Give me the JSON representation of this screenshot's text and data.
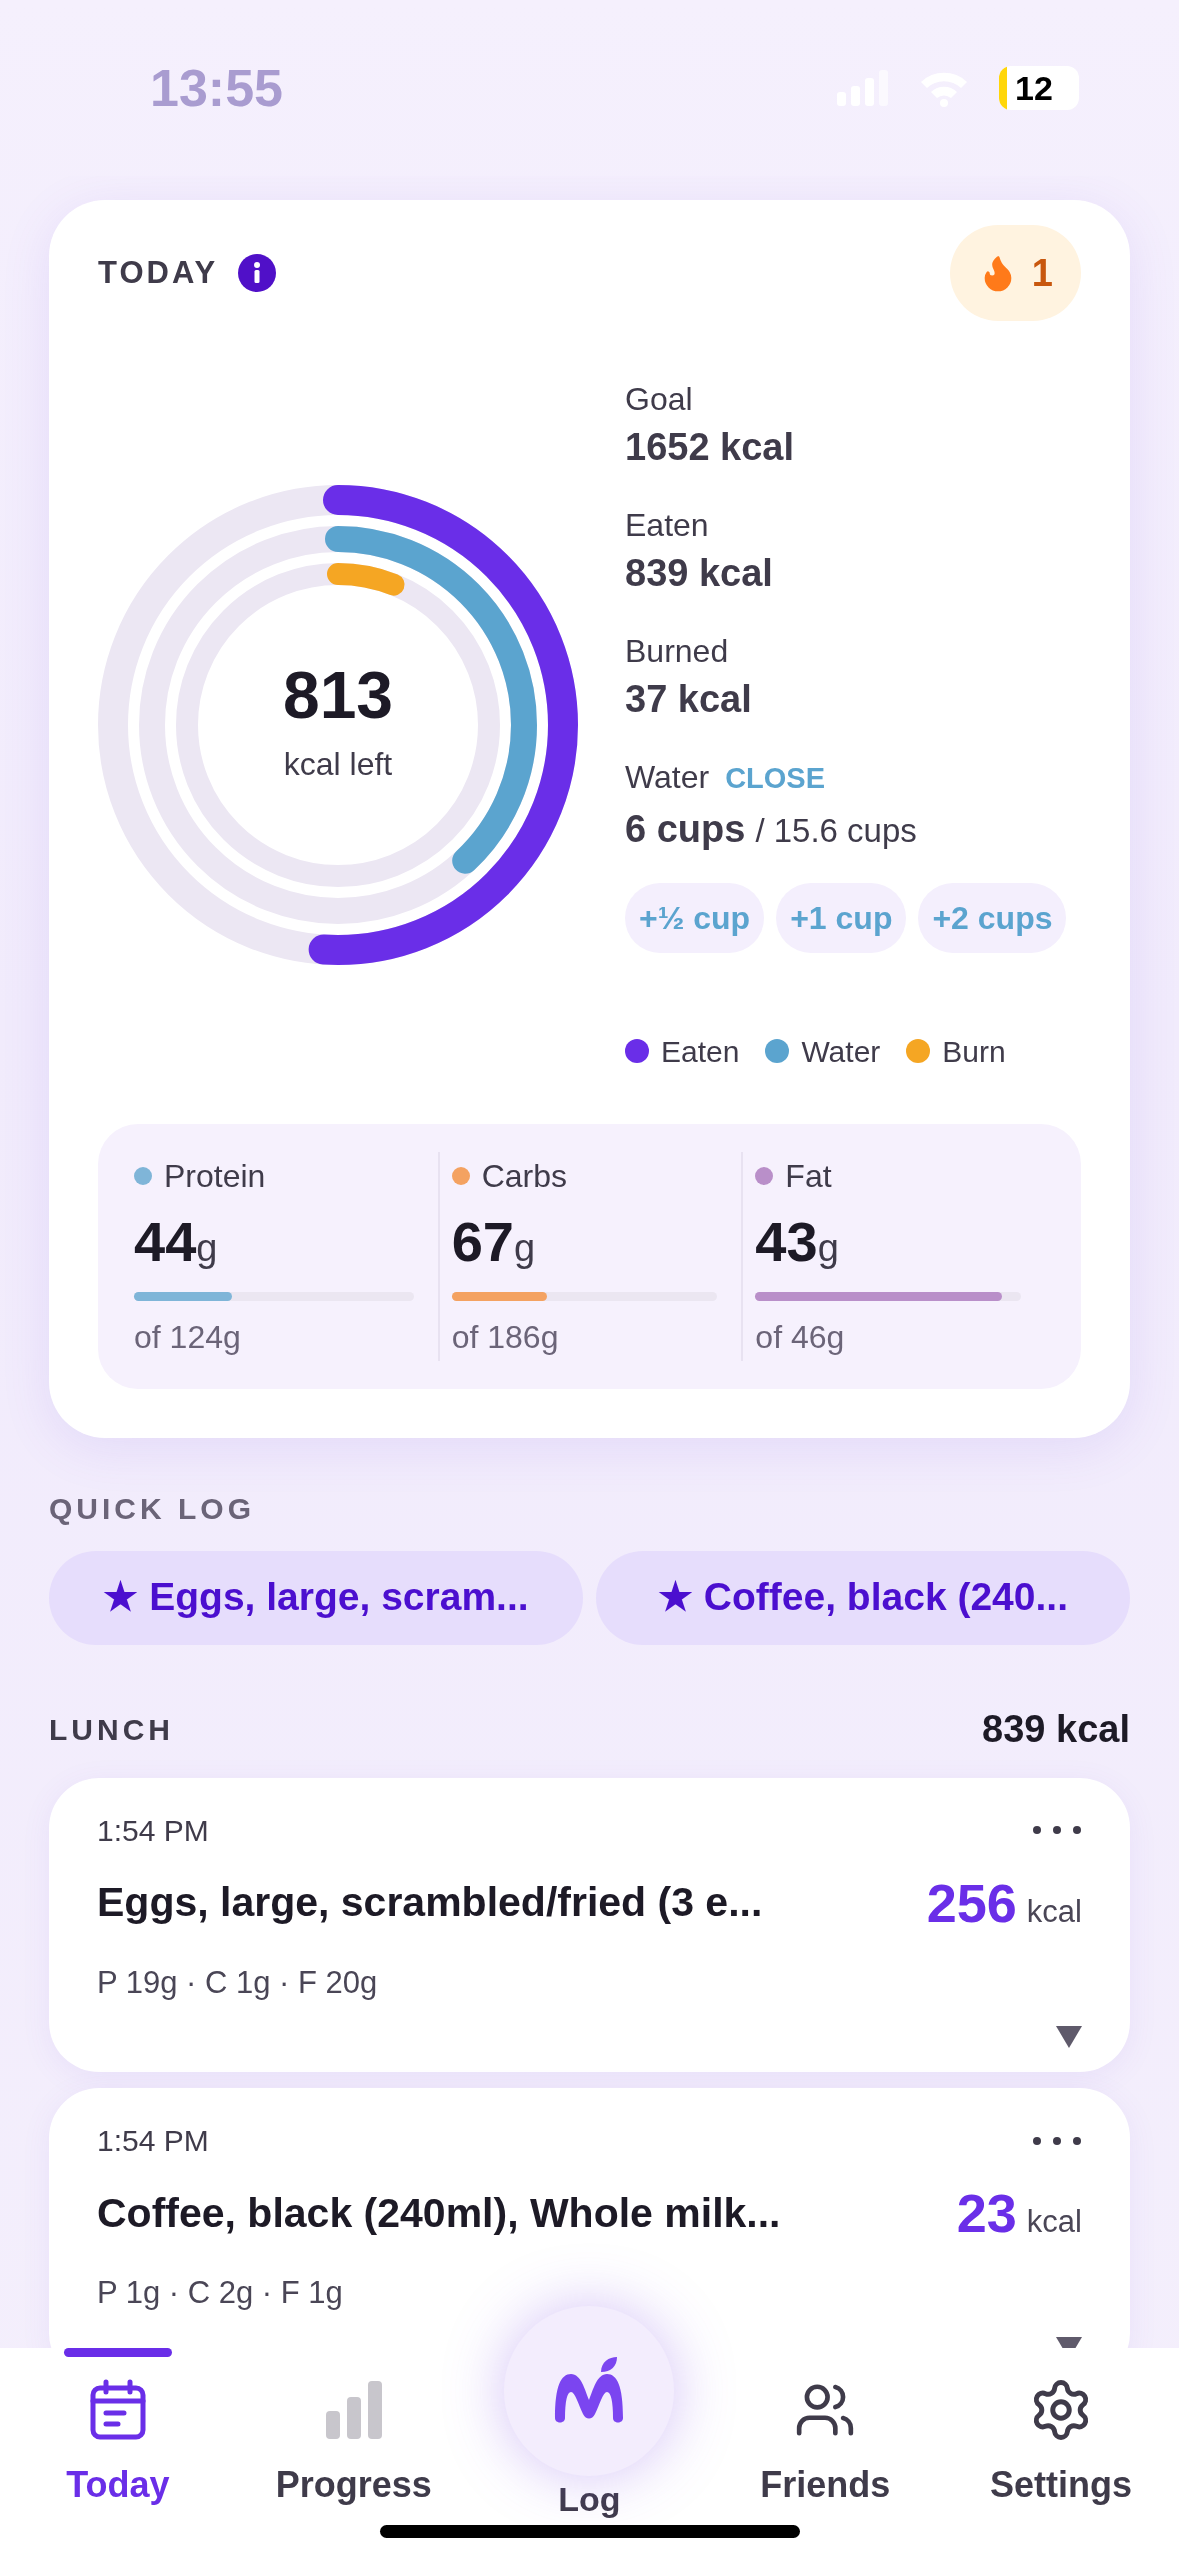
{
  "status_bar": {
    "time": "13:55",
    "battery": "12"
  },
  "today": {
    "title": "TODAY",
    "streak": "1",
    "ring": {
      "value": "813",
      "caption": "kcal left",
      "arcs": [
        {
          "level": 0.51
        },
        {
          "level": 0.38
        },
        {
          "level": 0.06
        }
      ]
    },
    "stats": [
      {
        "label": "Goal",
        "value": "1652 kcal"
      },
      {
        "label": "Eaten",
        "value": "839 kcal"
      },
      {
        "label": "Burned",
        "value": "37 kcal"
      }
    ],
    "water": {
      "label": "Water",
      "action": "CLOSE",
      "value": "6 cups",
      "goal": "/ 15.6 cups",
      "buttons": [
        "+½ cup",
        "+1 cup",
        "+2 cups"
      ]
    },
    "legend": [
      {
        "label": "Eaten",
        "color": "#6a2ee8"
      },
      {
        "label": "Water",
        "color": "#5ba4cf"
      },
      {
        "label": "Burn",
        "color": "#f5a623"
      }
    ],
    "macros": [
      {
        "name": "Protein",
        "color": "#7fb5d8",
        "value": "44",
        "unit": "g",
        "goal": "of 124g",
        "level": 0.35
      },
      {
        "name": "Carbs",
        "color": "#f4a261",
        "value": "67",
        "unit": "g",
        "goal": "of 186g",
        "level": 0.36
      },
      {
        "name": "Fat",
        "color": "#b98fc9",
        "value": "43",
        "unit": "g",
        "goal": "of 46g",
        "level": 0.93
      }
    ]
  },
  "quick_log": {
    "title": "QUICK LOG",
    "items": [
      "★ Eggs, large, scram...",
      "★ Coffee, black (240..."
    ]
  },
  "meal": {
    "title": "LUNCH",
    "total": "839 kcal",
    "entries": [
      {
        "time": "1:54 PM",
        "name": "Eggs, large, scrambled/fried (3 e...",
        "kcal": "256",
        "unit": "kcal",
        "macros": "P 19g · C 1g · F 20g"
      },
      {
        "time": "1:54 PM",
        "name": "Coffee, black (240ml), Whole milk...",
        "kcal": "23",
        "unit": "kcal",
        "macros": "P 1g · C 2g · F 1g"
      }
    ]
  },
  "nav": [
    {
      "label": "Today",
      "kind": "today",
      "selected": true
    },
    {
      "label": "Progress",
      "kind": "progress",
      "selected": false
    },
    {
      "label": "Log",
      "kind": "log",
      "selected": false
    },
    {
      "label": "Friends",
      "kind": "friends",
      "selected": false
    },
    {
      "label": "Settings",
      "kind": "settings",
      "selected": false
    }
  ]
}
